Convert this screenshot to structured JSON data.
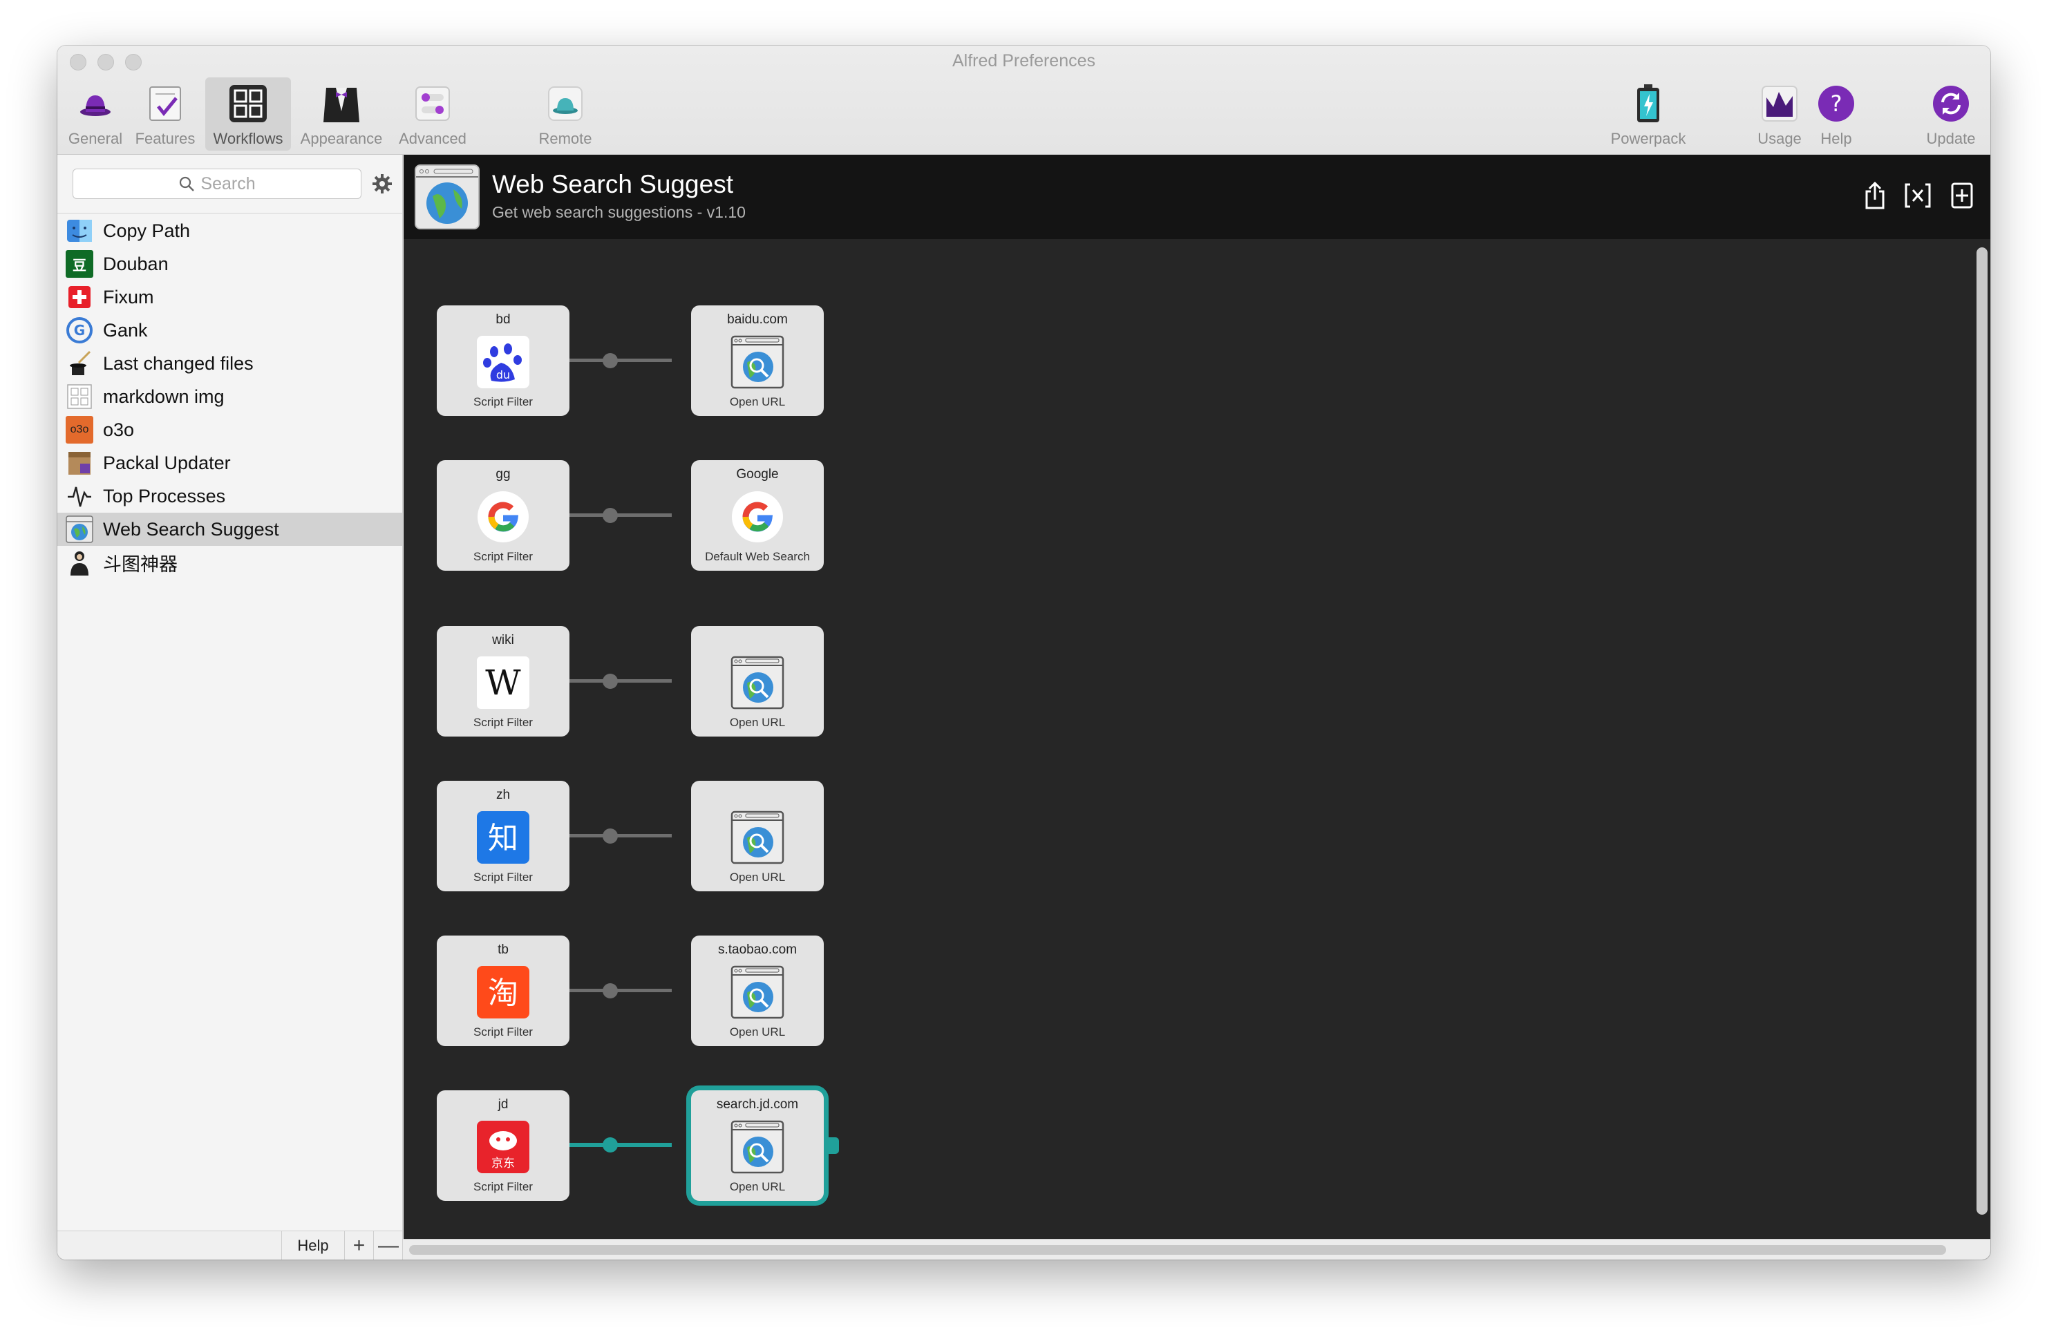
{
  "window": {
    "title": "Alfred Preferences"
  },
  "toolbar": {
    "items": [
      {
        "label": "General",
        "icon": "hat-icon"
      },
      {
        "label": "Features",
        "icon": "features-checklist-icon"
      },
      {
        "label": "Workflows",
        "icon": "workflows-grid-icon"
      },
      {
        "label": "Appearance",
        "icon": "tuxedo-icon"
      },
      {
        "label": "Advanced",
        "icon": "advanced-toggles-icon"
      },
      {
        "label": "Remote",
        "icon": "remote-hat-icon"
      },
      {
        "label": "Powerpack",
        "icon": "powerpack-battery-icon"
      },
      {
        "label": "Usage",
        "icon": "usage-chart-icon"
      },
      {
        "label": "Help",
        "icon": "help-icon"
      },
      {
        "label": "Update",
        "icon": "update-icon"
      }
    ],
    "active": "Workflows"
  },
  "sidebar": {
    "search_placeholder": "Search",
    "workflows": [
      {
        "name": "Copy Path",
        "icon": "finder-icon"
      },
      {
        "name": "Douban",
        "icon": "douban-icon"
      },
      {
        "name": "Fixum",
        "icon": "fixum-icon"
      },
      {
        "name": "Gank",
        "icon": "gank-icon"
      },
      {
        "name": "Last changed files",
        "icon": "wand-hat-icon"
      },
      {
        "name": "markdown img",
        "icon": "markdown-grid-icon"
      },
      {
        "name": "o3o",
        "icon": "o3o-icon"
      },
      {
        "name": "Packal Updater",
        "icon": "packal-box-icon"
      },
      {
        "name": "Top Processes",
        "icon": "activity-icon"
      },
      {
        "name": "Web Search Suggest",
        "icon": "globe-window-icon"
      },
      {
        "name": "斗图神器",
        "icon": "person-icon"
      }
    ],
    "selected": "Web Search Suggest",
    "help_label": "Help",
    "add_label": "+",
    "remove_label": "—"
  },
  "workflow": {
    "title": "Web Search Suggest",
    "subtitle": "Get web search suggestions - v1.10",
    "header_actions": [
      "share-icon",
      "variables-icon",
      "add-object-icon",
      "debug-bug-icon"
    ],
    "rows": [
      {
        "left": {
          "title": "bd",
          "type": "Script Filter",
          "icon": "baidu-icon"
        },
        "right": {
          "title": "baidu.com",
          "type": "Open URL",
          "icon": "open-url-icon"
        }
      },
      {
        "left": {
          "title": "gg",
          "type": "Script Filter",
          "icon": "google-icon"
        },
        "right": {
          "title": "Google",
          "type": "Default Web Search",
          "icon": "google-icon"
        }
      },
      {
        "left": {
          "title": "wiki",
          "type": "Script Filter",
          "icon": "wikipedia-icon"
        },
        "right": {
          "title": "",
          "type": "Open URL",
          "icon": "open-url-icon"
        }
      },
      {
        "left": {
          "title": "zh",
          "type": "Script Filter",
          "icon": "zhihu-icon"
        },
        "right": {
          "title": "",
          "type": "Open URL",
          "icon": "open-url-icon"
        }
      },
      {
        "left": {
          "title": "tb",
          "type": "Script Filter",
          "icon": "taobao-icon"
        },
        "right": {
          "title": "s.taobao.com",
          "type": "Open URL",
          "icon": "open-url-icon"
        }
      },
      {
        "left": {
          "title": "jd",
          "type": "Script Filter",
          "icon": "jd-icon"
        },
        "right": {
          "title": "search.jd.com",
          "type": "Open URL",
          "icon": "open-url-icon"
        }
      }
    ],
    "selected_row": 5
  },
  "glyphs": {
    "zhihu": "知",
    "taobao": "淘",
    "jd_text": "京东",
    "douban": "豆",
    "wiki": "W",
    "o3o": "o3o",
    "baidu": "du"
  },
  "colors": {
    "selection_teal": "#20a09a",
    "canvas_bg": "#262626",
    "header_bg": "#141414",
    "alfred_purple": "#7a2bb5"
  }
}
